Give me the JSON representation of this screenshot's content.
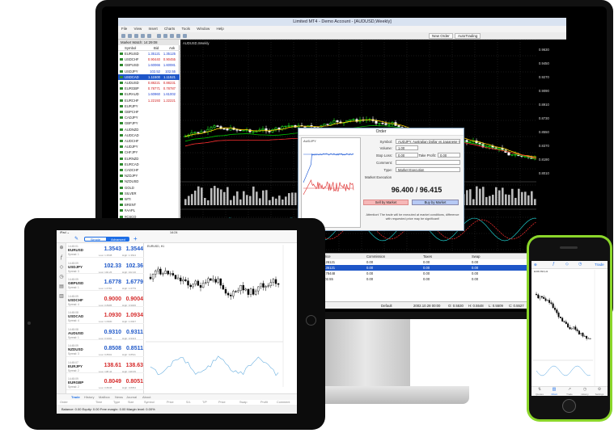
{
  "monitor": {
    "window_title": "Limited MT4 - Demo Account - [AUDUSD,Weekly]",
    "menu": [
      "File",
      "View",
      "Insert",
      "Charts",
      "Tools",
      "Window",
      "Help"
    ],
    "toolbar": {
      "new_order": "New Order",
      "autotrading": "AutoTrading"
    },
    "market_watch": {
      "title": "Market Watch: 14:29:08",
      "columns": [
        "Symbol",
        "Bid",
        "Ask"
      ],
      "rows": [
        {
          "symbol": "EURUSD",
          "bid": "1.35121",
          "ask": "1.35125",
          "dir": "up"
        },
        {
          "symbol": "USDCHF",
          "bid": "0.90440",
          "ask": "0.90455",
          "dir": "dn"
        },
        {
          "symbol": "GBPUSD",
          "bid": "1.60066",
          "ask": "1.60081",
          "dir": "up"
        },
        {
          "symbol": "USDJPY",
          "bid": "102.52",
          "ask": "102.55",
          "dir": "up"
        },
        {
          "symbol": "USDCAD",
          "bid": "1.11500",
          "ask": "1.11521",
          "dir": "sel"
        },
        {
          "symbol": "AUDUSD",
          "bid": "0.88221",
          "ask": "0.88231",
          "dir": "dn"
        },
        {
          "symbol": "EURGBP",
          "bid": "0.78771",
          "ask": "0.78787",
          "dir": "dn"
        },
        {
          "symbol": "EURAUD",
          "bid": "1.60960",
          "ask": "1.61002",
          "dir": "up"
        },
        {
          "symbol": "EURCHF",
          "bid": "1.22193",
          "ask": "1.22221",
          "dir": "dn"
        },
        {
          "symbol": "EURJPY",
          "bid": "",
          "ask": "",
          "dir": ""
        },
        {
          "symbol": "GBPCHF",
          "bid": "",
          "ask": "",
          "dir": ""
        },
        {
          "symbol": "CADJPY",
          "bid": "",
          "ask": "",
          "dir": ""
        },
        {
          "symbol": "GBPJPY",
          "bid": "",
          "ask": "",
          "dir": ""
        },
        {
          "symbol": "AUDNZD",
          "bid": "",
          "ask": "",
          "dir": ""
        },
        {
          "symbol": "AUDCAD",
          "bid": "",
          "ask": "",
          "dir": ""
        },
        {
          "symbol": "AUDCHF",
          "bid": "",
          "ask": "",
          "dir": ""
        },
        {
          "symbol": "AUDJPY",
          "bid": "",
          "ask": "",
          "dir": ""
        },
        {
          "symbol": "CHFJPY",
          "bid": "",
          "ask": "",
          "dir": ""
        },
        {
          "symbol": "EURNZD",
          "bid": "",
          "ask": "",
          "dir": ""
        },
        {
          "symbol": "EURCAD",
          "bid": "",
          "ask": "",
          "dir": ""
        },
        {
          "symbol": "CADCHF",
          "bid": "",
          "ask": "",
          "dir": ""
        },
        {
          "symbol": "NZDJPY",
          "bid": "",
          "ask": "",
          "dir": ""
        },
        {
          "symbol": "NZDUSD",
          "bid": "",
          "ask": "",
          "dir": ""
        },
        {
          "symbol": "GOLD",
          "bid": "",
          "ask": "",
          "dir": ""
        },
        {
          "symbol": "SILVER",
          "bid": "",
          "ask": "",
          "dir": ""
        },
        {
          "symbol": "WTI",
          "bid": "",
          "ask": "",
          "dir": ""
        },
        {
          "symbol": "BRENT",
          "bid": "",
          "ask": "",
          "dir": ""
        },
        {
          "symbol": "#AAPL",
          "bid": "",
          "ask": "",
          "dir": ""
        },
        {
          "symbol": "#CSCO",
          "bid": "",
          "ask": "",
          "dir": ""
        },
        {
          "symbol": "#IBM",
          "bid": "",
          "ask": "",
          "dir": ""
        },
        {
          "symbol": "#MSFT",
          "bid": "",
          "ask": "",
          "dir": ""
        }
      ]
    },
    "chart": {
      "title": "AUDUSD,Weekly",
      "price_labels": [
        "0.9630",
        "0.9450",
        "0.9270",
        "0.9090",
        "0.8910",
        "0.8730",
        "0.8550",
        "0.8370",
        "0.8190",
        "0.8010"
      ]
    },
    "order": {
      "title": "Order",
      "symbol_label": "Symbol:",
      "symbol_value": "AUDJPY, Australian Dollar vs Japanese Yen",
      "volume_label": "Volume:",
      "volume_value": "1.00",
      "stoploss_label": "Stop Loss:",
      "stoploss_value": "0.00",
      "takeprofit_label": "Take Profit:",
      "takeprofit_value": "0.00",
      "comment_label": "Comment:",
      "comment_value": "",
      "type_label": "Type:",
      "type_value": "Market Execution",
      "section": "Market Execution",
      "price": "96.400 / 96.415",
      "sell": "Sell by Market",
      "buy": "Buy by Market",
      "attention": "Attention! The trade will be executed at market conditions, difference with requested price may be significant!",
      "mini_chart_title": "AUDJPY"
    },
    "terminal": {
      "columns": [
        "Price",
        "S / L",
        "T / P",
        "Price",
        "Commission",
        "Taxes",
        "Swap"
      ],
      "rows": [
        [
          "",
          "0.00",
          "0.00",
          "1.26121",
          "0.00",
          "0.00",
          "0.00"
        ],
        [
          "",
          "0.00",
          "0.00",
          "1.35121",
          "0.00",
          "0.00",
          "0.00"
        ],
        [
          "",
          "0.00",
          "0.00",
          "0.78448",
          "0.00",
          "0.00",
          "0.00"
        ],
        [
          "",
          "0.00",
          "0.00",
          "102.55",
          "0.00",
          "0.00",
          "0.00"
        ]
      ]
    },
    "status": {
      "profile": "Default",
      "time": "2002.10.28 00:00",
      "o": "O: 0.5530",
      "h": "H: 0.5548",
      "l": "L: 0.5509",
      "c": "C: 0.5527",
      "v": "V: 47"
    }
  },
  "tablet": {
    "status_left": "iPad ⌄",
    "status_time": "14:24",
    "segments": [
      "Simple",
      "Advanced"
    ],
    "quotes": [
      {
        "time": "14:45:01",
        "symbol": "EURUSD",
        "spread": "Spread: 1",
        "bid": "1.3543",
        "ask": "1.3544",
        "low": "Low: 1.3538",
        "high": "High: 1.3544",
        "color": "blue"
      },
      {
        "time": "14:45:09",
        "symbol": "USDJPY",
        "spread": "Spread: 3",
        "bid": "102.33",
        "ask": "102.36",
        "low": "Low: 102.26",
        "high": "High: 102.40",
        "color": "blue"
      },
      {
        "time": "14:45:09",
        "symbol": "GBPUSD",
        "spread": "Spread: 1",
        "bid": "1.6778",
        "ask": "1.6779",
        "low": "Low: 1.6762",
        "high": "High: 1.6779",
        "color": "blue"
      },
      {
        "time": "14:45:09",
        "symbol": "USDCHF",
        "spread": "Spread: 4",
        "bid": "0.9000",
        "ask": "0.9004",
        "low": "Low: 0.8995",
        "high": "High: 0.9006",
        "color": "red"
      },
      {
        "time": "14:45:08",
        "symbol": "USDCAD",
        "spread": "Spread: 4",
        "bid": "1.0930",
        "ask": "1.0934",
        "low": "Low: 1.0930",
        "high": "High: 1.0947",
        "color": "red"
      },
      {
        "time": "14:45:08",
        "symbol": "AUDUSD",
        "spread": "Spread: 1",
        "bid": "0.9310",
        "ask": "0.9311",
        "low": "Low: 0.9302",
        "high": "High: 0.9313",
        "color": "blue"
      },
      {
        "time": "14:45:09",
        "symbol": "NZDUSD",
        "spread": "Spread: 3",
        "bid": "0.8508",
        "ask": "0.8511",
        "low": "Low: 0.8501",
        "high": "High: 0.8511",
        "color": "blue"
      },
      {
        "time": "14:45:07",
        "symbol": "EURJPY",
        "spread": "Spread: 2",
        "bid": "138.61",
        "ask": "138.63",
        "low": "Low: 138.44",
        "high": "High: 138.65",
        "color": "red"
      },
      {
        "time": "14:45:09",
        "symbol": "EURGBP",
        "spread": "Spread: 2",
        "bid": "0.8049",
        "ask": "0.8051",
        "low": "Low: 0.8048",
        "high": "High: 0.8054",
        "color": "red"
      }
    ],
    "chart_title": "EURUSD, H1",
    "tabs": [
      "Trade",
      "History",
      "Mailbox",
      "News",
      "Journal",
      "About"
    ],
    "columns": [
      "Order",
      "Time",
      "Type",
      "Size",
      "Symbol",
      "Price",
      "S/L",
      "T/P",
      "Price",
      "Swap",
      "Profit",
      "Comment"
    ],
    "balance": "Balance: 0.00 Equity: 0.00 Free margin: 0.00 Margin level: 0.00%"
  },
  "phone": {
    "trade": "Trade",
    "chart_title": "EURUSD,H1",
    "tabs": [
      "Quotes",
      "Chart",
      "Trade",
      "History",
      "Settings"
    ]
  }
}
